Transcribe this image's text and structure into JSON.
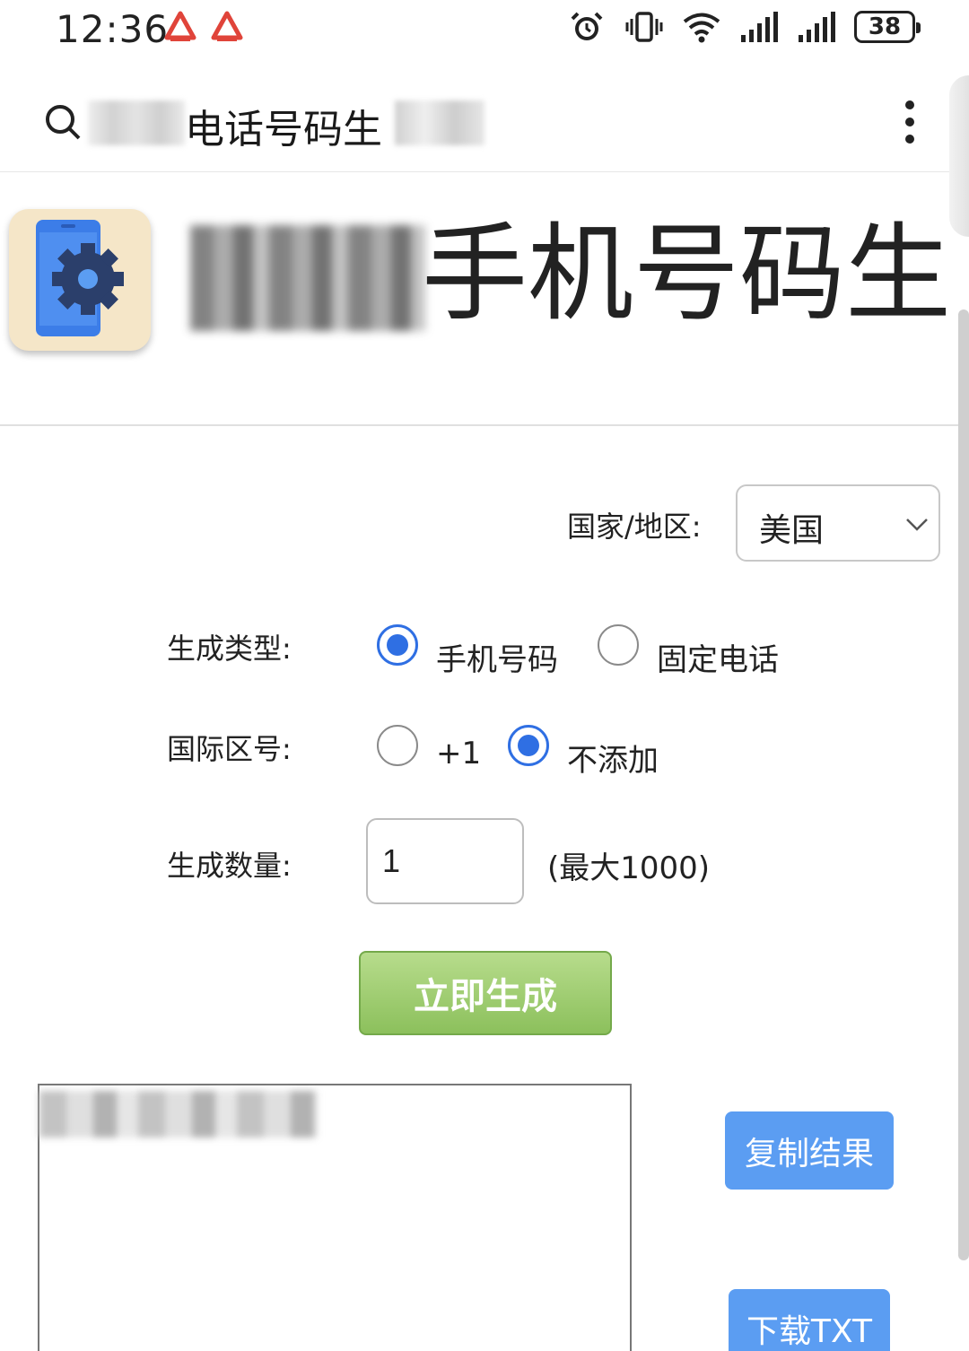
{
  "status_bar": {
    "time": "12:36",
    "battery": "38",
    "icons": [
      "alarm-icon",
      "vibrate-icon",
      "wifi-icon",
      "signal-icon",
      "signal-icon"
    ]
  },
  "browser": {
    "title": "电话号码生"
  },
  "header": {
    "title": "手机号码生"
  },
  "form": {
    "country_label": "国家/地区:",
    "country_value": "美国",
    "type_label": "生成类型:",
    "type_options": [
      "手机号码",
      "固定电话"
    ],
    "type_selected": "手机号码",
    "code_label": "国际区号:",
    "code_options": [
      "+1",
      "不添加"
    ],
    "code_selected": "不添加",
    "qty_label": "生成数量:",
    "qty_value": "1",
    "qty_note": "(最大1000)",
    "generate_label": "立即生成"
  },
  "actions": {
    "copy_label": "复制结果",
    "download_label": "下载TXT"
  },
  "colors": {
    "accent": "#2f6fe3",
    "generate_button": "#8cc05c",
    "action_button": "#5b9df2"
  }
}
